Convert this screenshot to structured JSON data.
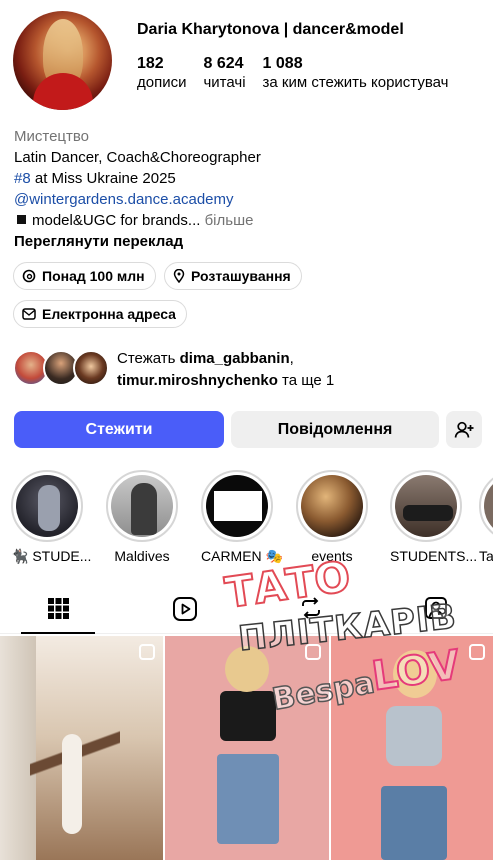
{
  "profile": {
    "username": "Daria Kharytonova | dancer&model",
    "stats": [
      {
        "value": "182",
        "label": "дописи"
      },
      {
        "value": "8 624",
        "label": "читачі"
      },
      {
        "value": "1 088",
        "label": "за ким стежить користувач"
      }
    ]
  },
  "bio": {
    "category": "Мистецтво",
    "line1": "Latin Dancer, Coach&Choreographer",
    "line2_tag": "#8",
    "line2_rest": " at Miss Ukraine 2025",
    "link": "@wintergardens.dance.academy",
    "line4": "model&UGC for brands...",
    "more": " більше",
    "translate": "Переглянути переклад"
  },
  "chips": {
    "threads": "Понад 100 млн",
    "location": "Розташування",
    "email": "Електронна адреса"
  },
  "followed_by": {
    "prefix": "Стежать ",
    "user1": "dima_gabbanin",
    "comma": ",",
    "user2": "timur.miroshnychenko",
    "suffix": " та ще 1"
  },
  "actions": {
    "follow": "Стежити",
    "message": "Повідомлення"
  },
  "highlights": [
    {
      "label": "🐈‍⬛ STUDE..."
    },
    {
      "label": "Maldives"
    },
    {
      "label": "CARMEN 🎭"
    },
    {
      "label": "events"
    },
    {
      "label": "STUDENTS..."
    },
    {
      "label": "Ta"
    }
  ],
  "watermark": {
    "line1": "ТАТО",
    "line2": "ПЛІТКАРІВ",
    "line3": "Bespa",
    "line4": "LOV"
  },
  "colors": {
    "follow_button": "#4a5df9",
    "link": "#1c4ea7",
    "secondary_text": "#737373"
  }
}
